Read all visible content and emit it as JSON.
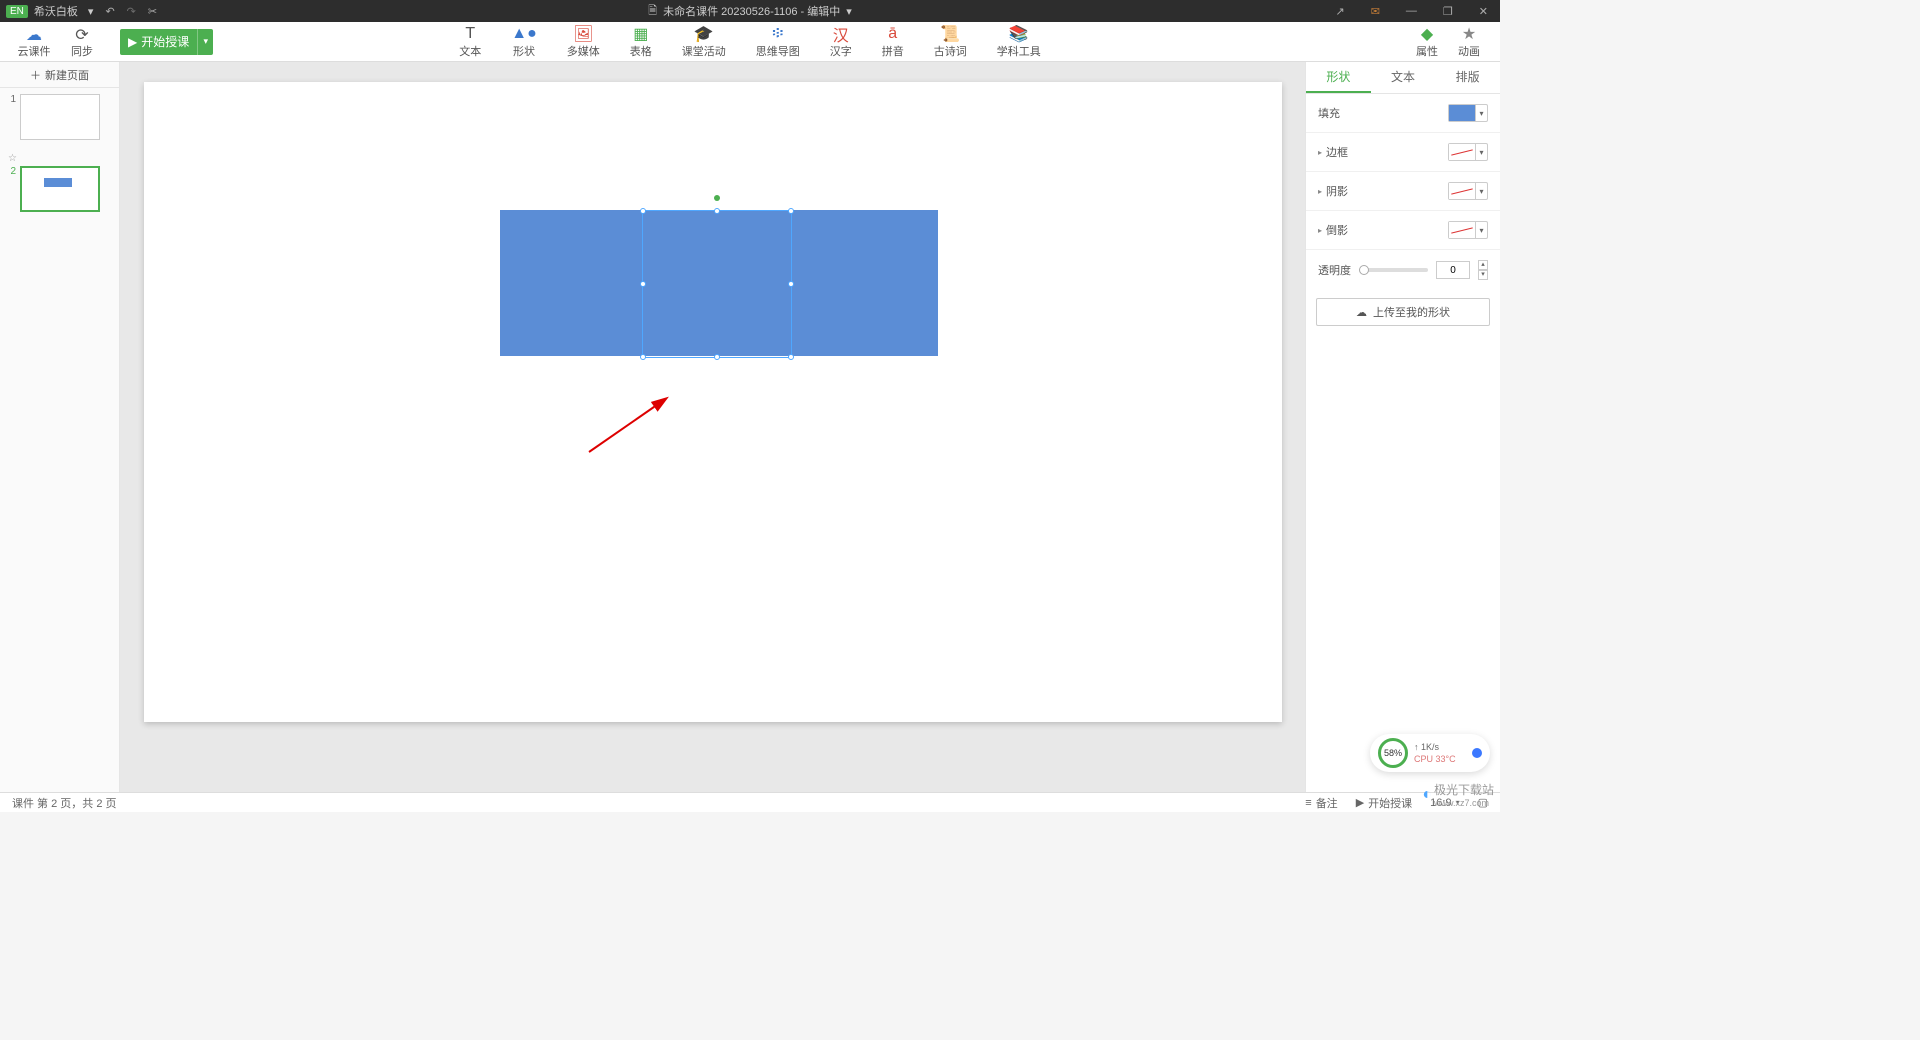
{
  "titlebar": {
    "app_badge": "EN",
    "app_name": "希沃白板",
    "dropdown": "▾",
    "undo": "↶",
    "redo": "↷",
    "cut": "✂",
    "doc_icon": "🗎",
    "doc_title": "未命名课件 20230526-1106 - 编辑中",
    "doc_drop": "▾",
    "share": "↗",
    "mail": "✉",
    "minimize": "—",
    "maximize": "❐",
    "close": "✕"
  },
  "toolbar": {
    "cloud_label": "云课件",
    "sync_label": "同步",
    "start_label": "开始授课",
    "tools": [
      {
        "icon": "T",
        "label": "文本"
      },
      {
        "icon": "▲●",
        "label": "形状"
      },
      {
        "icon": "🖼",
        "label": "多媒体"
      },
      {
        "icon": "▦",
        "label": "表格"
      },
      {
        "icon": "🎓",
        "label": "课堂活动"
      },
      {
        "icon": "፨",
        "label": "思维导图"
      },
      {
        "icon": "汉",
        "label": "汉字"
      },
      {
        "icon": "ā",
        "label": "拼音"
      },
      {
        "icon": "📜",
        "label": "古诗词"
      },
      {
        "icon": "📚",
        "label": "学科工具"
      }
    ],
    "attr_icon": "◆",
    "attr_label": "属性",
    "anim_icon": "★",
    "anim_label": "动画"
  },
  "leftpanel": {
    "new_page": "新建页面",
    "thumbs": [
      {
        "num": "1"
      },
      {
        "num": "2"
      }
    ]
  },
  "rightpanel": {
    "tabs": {
      "shape": "形状",
      "text": "文本",
      "layout": "排版"
    },
    "fill_label": "填充",
    "border_label": "边框",
    "shadow_label": "阴影",
    "reflect_label": "倒影",
    "opacity_label": "透明度",
    "opacity_value": "0",
    "upload_label": "上传至我的形状"
  },
  "statusbar": {
    "page_info": "课件 第 2 页，共 2 页",
    "notes": "备注",
    "start": "开始授课",
    "ratio": "16:9",
    "pane_icon": "▢"
  },
  "perf": {
    "percent": "58%",
    "net": "↑  1K/s",
    "cpu": "CPU 33°C"
  },
  "watermark": "极光下载站",
  "watermark_url": "www.xz7.com"
}
